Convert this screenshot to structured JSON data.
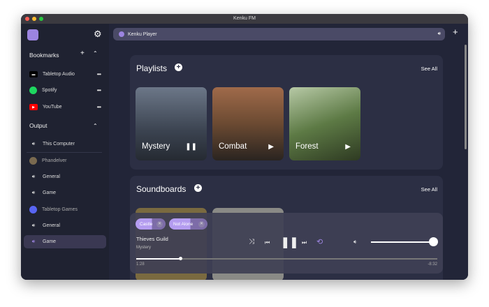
{
  "window": {
    "title": "Kenku FM"
  },
  "sidebar": {
    "bookmarks_title": "Bookmarks",
    "bookmarks": [
      {
        "label": "Tabletop Audio"
      },
      {
        "label": "Spotify"
      },
      {
        "label": "YouTube"
      }
    ],
    "output_title": "Output",
    "outputs": [
      {
        "label": "This Computer"
      },
      {
        "label": "Phandelver"
      },
      {
        "label": "General"
      },
      {
        "label": "Game"
      },
      {
        "label": "Tabletop Games"
      },
      {
        "label": "General"
      },
      {
        "label": "Game"
      }
    ]
  },
  "topbar": {
    "tab_label": "Kenku Player"
  },
  "playlists": {
    "title": "Playlists",
    "see_all": "See All",
    "items": [
      {
        "name": "Mystery",
        "state": "playing"
      },
      {
        "name": "Combat",
        "state": "paused"
      },
      {
        "name": "Forest",
        "state": "paused"
      }
    ]
  },
  "soundboards": {
    "title": "Soundboards",
    "see_all": "See All"
  },
  "player": {
    "chips": [
      {
        "label": "Castle",
        "progress": 0.55
      },
      {
        "label": "Not Alone",
        "progress": 0.55
      }
    ],
    "track": "Thieves Guild",
    "playlist": "Mystery",
    "elapsed": "1:28",
    "remaining": "-8:32",
    "progress": 0.147,
    "volume": 1.0
  },
  "colors": {
    "accent": "#9c84e0"
  }
}
